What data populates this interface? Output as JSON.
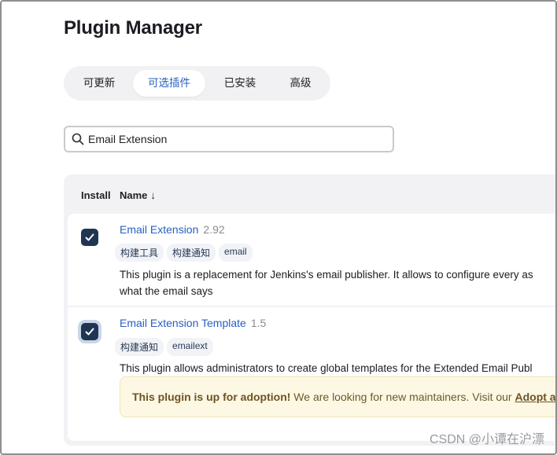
{
  "page": {
    "title": "Plugin Manager"
  },
  "tabs": [
    {
      "label": "可更新",
      "active": false
    },
    {
      "label": "可选插件",
      "active": true
    },
    {
      "label": "已安装",
      "active": false
    },
    {
      "label": "高级",
      "active": false
    }
  ],
  "search": {
    "value": "Email Extension",
    "placeholder": ""
  },
  "table": {
    "headers": {
      "install": "Install",
      "name": "Name",
      "sort_arrow": "↓"
    },
    "rows": [
      {
        "name": "Email Extension",
        "version": "2.92",
        "checked": true,
        "tags": [
          "构建工具",
          "构建通知",
          "email"
        ],
        "description_line1": "This plugin is a replacement for Jenkins's email publisher. It allows to configure every as",
        "description_line2": "what the email says"
      },
      {
        "name": "Email Extension Template",
        "version": "1.5",
        "checked": true,
        "tags": [
          "构建通知",
          "emailext"
        ],
        "description_line1": "This plugin allows administrators to create global templates for the Extended Email Publ",
        "adoption": {
          "bold": "This plugin is up for adoption!",
          "text": " We are looking for new maintainers. Visit our ",
          "link": "Adopt a"
        }
      }
    ]
  },
  "watermark": "CSDN @小谭在沪漂",
  "colors": {
    "accent": "#2760c2",
    "checkbox": "#1f3552",
    "adopt_bg": "#fdf8e3"
  }
}
